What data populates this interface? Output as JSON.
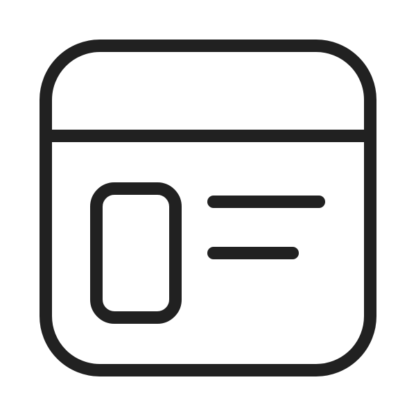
{
  "icon": {
    "name": "browser-window-layout-icon",
    "stroke_color": "#212121",
    "background_color": "#ffffff"
  }
}
